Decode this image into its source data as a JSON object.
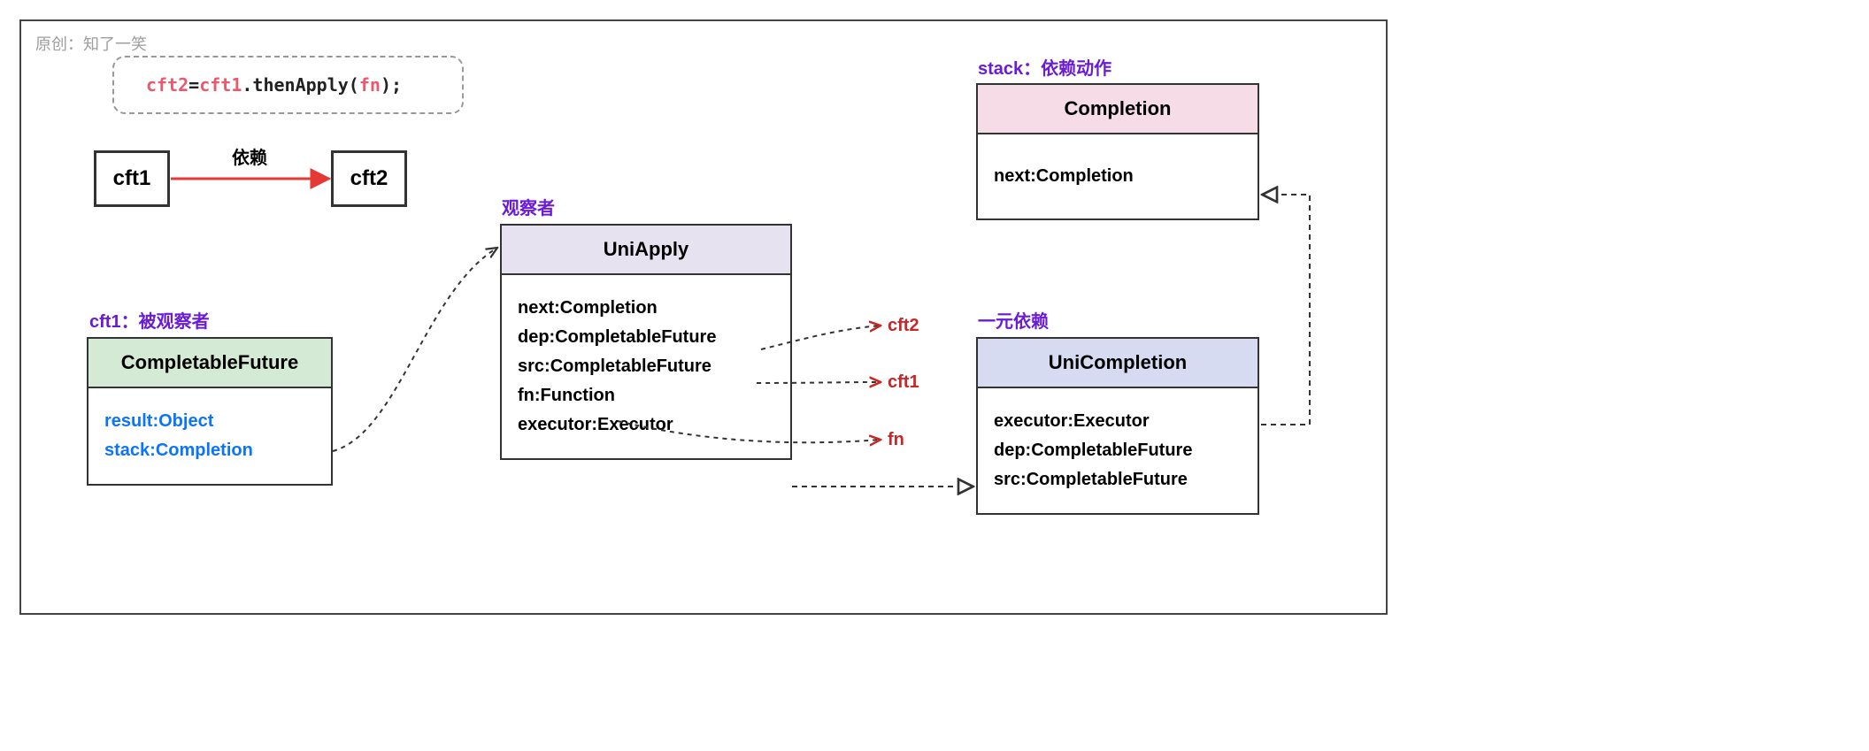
{
  "watermark": "原创：知了一笑",
  "code": {
    "left": "cft2",
    "eq": " = ",
    "mid": "cft1",
    "method": ".thenApply( ",
    "arg": "fn",
    "end": " );"
  },
  "small_boxes": {
    "cft1": "cft1",
    "cft2": "cft2",
    "dep_label": "依赖"
  },
  "captions": {
    "cft1": "cft1：被观察者",
    "observer": "观察者",
    "unary": "一元依赖",
    "stack": "stack：依赖动作"
  },
  "blocks": {
    "completable_future": {
      "title": "CompletableFuture",
      "fields": [
        "result:Object",
        "stack:Completion"
      ]
    },
    "uni_apply": {
      "title": "UniApply",
      "fields": [
        "next:Completion",
        "dep:CompletableFuture",
        "src:CompletableFuture",
        "fn:Function",
        "executor:Executor"
      ]
    },
    "uni_completion": {
      "title": "UniCompletion",
      "fields": [
        "executor:Executor",
        "dep:CompletableFuture",
        "src:CompletableFuture"
      ]
    },
    "completion": {
      "title": "Completion",
      "fields": [
        "next:Completion"
      ]
    }
  },
  "refs": {
    "cft2": "cft2",
    "cft1": "cft1",
    "fn": "fn"
  }
}
